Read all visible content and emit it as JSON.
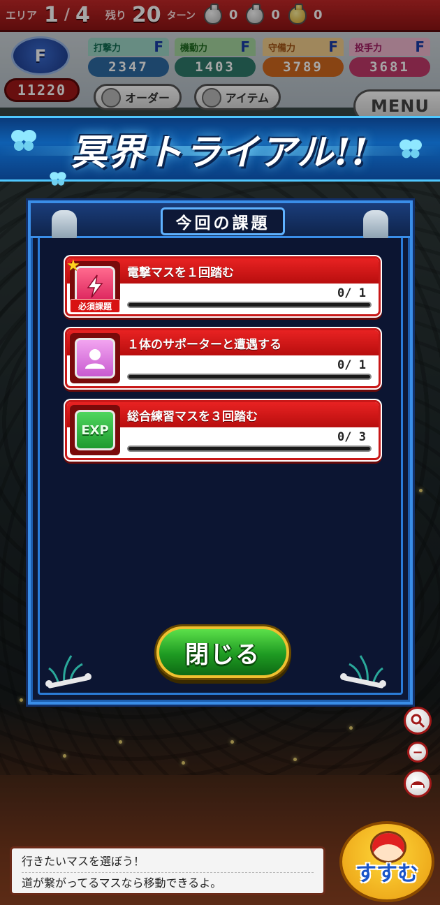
{
  "hud": {
    "area_label": "エリア",
    "area_current": "1",
    "area_separator": "/",
    "area_total": "4",
    "remaining_label": "残り",
    "turns_remaining": "20",
    "turn_label": "ターン",
    "bags": [
      {
        "icon": "silver-bag-icon",
        "count": "0"
      },
      {
        "icon": "silver-bag-icon",
        "count": "0"
      },
      {
        "icon": "gold-bag-icon",
        "count": "0"
      }
    ]
  },
  "stats": {
    "rank": "F",
    "points": "11220",
    "items": [
      {
        "key": "batting",
        "label": "打撃力",
        "grade": "F",
        "value": "2347"
      },
      {
        "key": "speed",
        "label": "機動力",
        "grade": "F",
        "value": "1403"
      },
      {
        "key": "defense",
        "label": "守備力",
        "grade": "F",
        "value": "3789"
      },
      {
        "key": "pitching",
        "label": "投手力",
        "grade": "F",
        "value": "3681"
      }
    ]
  },
  "nav": {
    "order_label": "オーダー",
    "item_label": "アイテム",
    "menu_label": "MENU"
  },
  "banner": {
    "title": "冥界トライアル!!"
  },
  "modal": {
    "heading": "今回の課題",
    "required_badge": "必須課題",
    "tasks": [
      {
        "icon": "lightning-icon",
        "title": "電撃マスを１回踏む",
        "progress": "0/ 1",
        "ratio": 0
      },
      {
        "icon": "person-icon",
        "title": "１体のサポーターと遭遇する",
        "progress": "0/ 1",
        "ratio": 0
      },
      {
        "icon": "exp-icon",
        "icon_text": "EXP",
        "title": "総合練習マスを３回踏む",
        "progress": "0/ 3",
        "ratio": 0
      }
    ],
    "close_label": "閉じる"
  },
  "message": {
    "lines": [
      "行きたいマスを選ぼう！",
      "道が繋がってるマスなら移動できるよ。"
    ]
  },
  "advance": {
    "label": "すすむ"
  },
  "colors": {
    "hud_red": "#c52828",
    "modal_bg": "#0d1836",
    "modal_border": "#3a8ee8",
    "task_red": "#e82222",
    "close_green": "#1e9a22"
  }
}
